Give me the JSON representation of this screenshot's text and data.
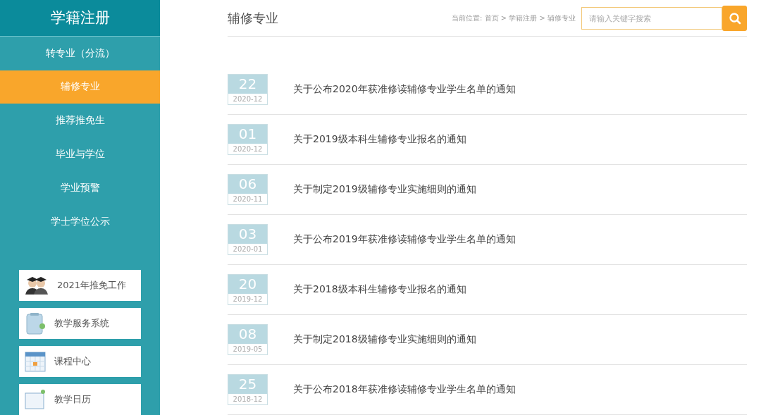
{
  "sidebar": {
    "title": "学籍注册",
    "items": [
      {
        "label": "转专业（分流）",
        "selected": false
      },
      {
        "label": "辅修专业",
        "selected": true
      },
      {
        "label": "推荐推免生",
        "selected": false
      },
      {
        "label": "毕业与学位",
        "selected": false
      },
      {
        "label": "学业预警",
        "selected": false
      },
      {
        "label": "学士学位公示",
        "selected": false
      }
    ],
    "links": [
      {
        "label": "2021年推免工作",
        "kind": "graduates"
      },
      {
        "label": "教学服务系统",
        "kind": "clipboard"
      },
      {
        "label": "课程中心",
        "kind": "calendar"
      },
      {
        "label": "教学日历",
        "kind": "note"
      }
    ]
  },
  "header": {
    "title": "辅修专业",
    "breadcrumb": "当前位置: 首页 > 学籍注册 > 辅修专业",
    "search": {
      "placeholder": "请输入关键字搜索"
    }
  },
  "news": [
    {
      "day": "22",
      "month": "2020-12",
      "title": "关于公布2020年获准修读辅修专业学生名单的通知"
    },
    {
      "day": "01",
      "month": "2020-12",
      "title": "关于2019级本科生辅修专业报名的通知"
    },
    {
      "day": "06",
      "month": "2020-11",
      "title": "关于制定2019级辅修专业实施细则的通知"
    },
    {
      "day": "03",
      "month": "2020-01",
      "title": "关于公布2019年获准修读辅修专业学生名单的通知"
    },
    {
      "day": "20",
      "month": "2019-12",
      "title": "关于2018级本科生辅修专业报名的通知"
    },
    {
      "day": "08",
      "month": "2019-05",
      "title": "关于制定2018级辅修专业实施细则的通知"
    },
    {
      "day": "25",
      "month": "2018-12",
      "title": "关于公布2018年获准修读辅修专业学生名单的通知"
    }
  ]
}
